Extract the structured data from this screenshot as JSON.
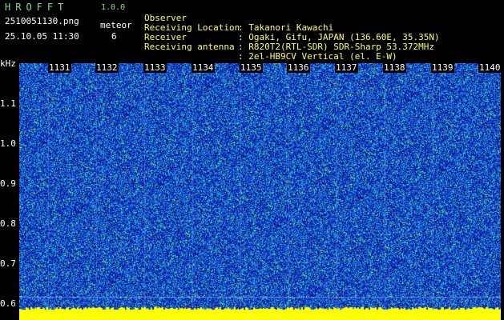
{
  "app": {
    "name": "HROFFT",
    "version": "1.0.0"
  },
  "file": {
    "name": "2510051130.png",
    "timestamp": "25.10.05 11:30"
  },
  "meteor": {
    "label": "meteor",
    "count": "6"
  },
  "station": [
    {
      "label": "Observer",
      "value": ": Takanori Kawachi"
    },
    {
      "label": "Receiving Location",
      "value": ": Ogaki, Gifu, JAPAN (136.60E, 35.35N)"
    },
    {
      "label": "Receiver",
      "value": ": R820T2(RTL-SDR) SDR-Sharp 53.372MHz"
    },
    {
      "label": "Receiving antenna",
      "value": ": 2el-HB9CV Vertical (el. E-W)"
    }
  ],
  "axes": {
    "freq_unit": "kHz",
    "freq_labels": [
      "1.1",
      "1.0",
      "0.9",
      "0.8",
      "0.7",
      "0.6"
    ],
    "time_labels": [
      "1131",
      "1132",
      "1133",
      "1134",
      "1135",
      "1136",
      "1137",
      "1138",
      "1139",
      "1140"
    ]
  },
  "colors": {
    "background": "#000000",
    "header_green": "#7fe07f",
    "noise_low": "#0a1a9c",
    "noise_mid": "#1e5fe0",
    "noise_high": "#24d0d0",
    "signal": "#9cf046",
    "baseline": "#ffff00"
  }
}
